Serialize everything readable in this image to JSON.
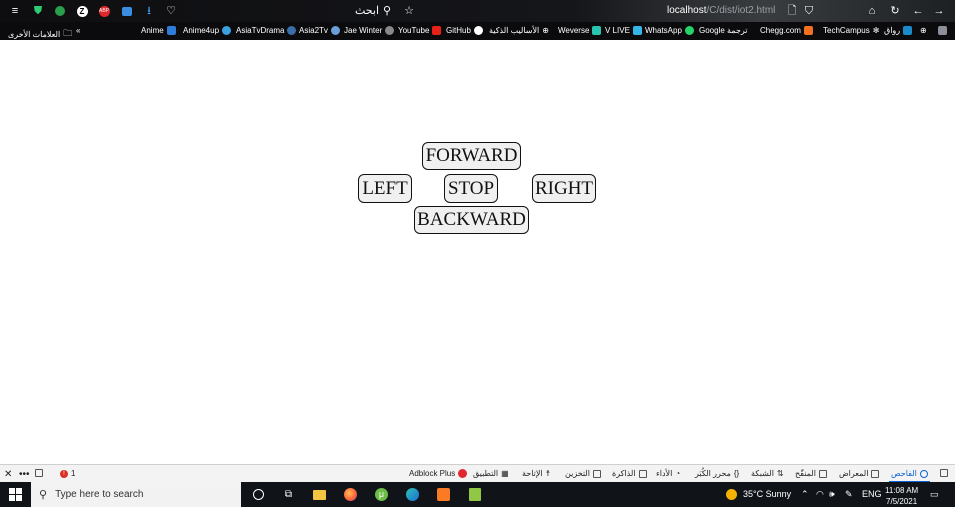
{
  "browser": {
    "search_label": "ابحث",
    "url_host": "localhost",
    "url_rest": "/C/dist/iot2.html"
  },
  "bookmarks": {
    "other_label": "العلامات الأخرى",
    "items": [
      {
        "label": "Anime",
        "color": "#2f7bd8"
      },
      {
        "label": "Anime4up",
        "color": "#3aa1e0"
      },
      {
        "label": "AsiaTvDrama",
        "color": "#3b6ea8"
      },
      {
        "label": "Asia2Tv",
        "color": "#6aa0d8"
      },
      {
        "label": "Jae Winter",
        "color": "#888888"
      },
      {
        "label": "YouTube",
        "color": "#e62117"
      },
      {
        "label": "GitHub",
        "color": "#ffffff"
      },
      {
        "label": "الأساليب الذكية",
        "color": "#bbbbbb"
      },
      {
        "label": "Weverse",
        "color": "#29c4b0"
      },
      {
        "label": "V LIVE",
        "color": "#34b6e8"
      },
      {
        "label": "WhatsApp",
        "color": "#25d366"
      },
      {
        "label": "Google ترجمة",
        "color": "#4285f4"
      },
      {
        "label": "Chegg.com",
        "color": "#f37021"
      },
      {
        "label": "TechCampus",
        "color": "#aaaaaa"
      },
      {
        "label": "رواق",
        "color": "#1a8acb"
      }
    ]
  },
  "controls": {
    "forward": "FORWARD",
    "left": "LEFT",
    "stop": "STOP",
    "right": "RIGHT",
    "backward": "BACKWARD"
  },
  "devtools": {
    "error_count": "1",
    "adblock": "Adblock Plus",
    "tabs": [
      "التطبيق",
      "الإتاحة",
      "التخزين",
      "الذاكرة",
      "الأداء",
      "محرر الكُبَر",
      "الشبكة",
      "المنقّح",
      "المعراض",
      "الفاحص"
    ]
  },
  "taskbar": {
    "search_placeholder": "Type here to search",
    "weather": "35°C  Sunny",
    "lang": "ENG",
    "time": "11:08 AM",
    "date": "7/5/2021"
  }
}
